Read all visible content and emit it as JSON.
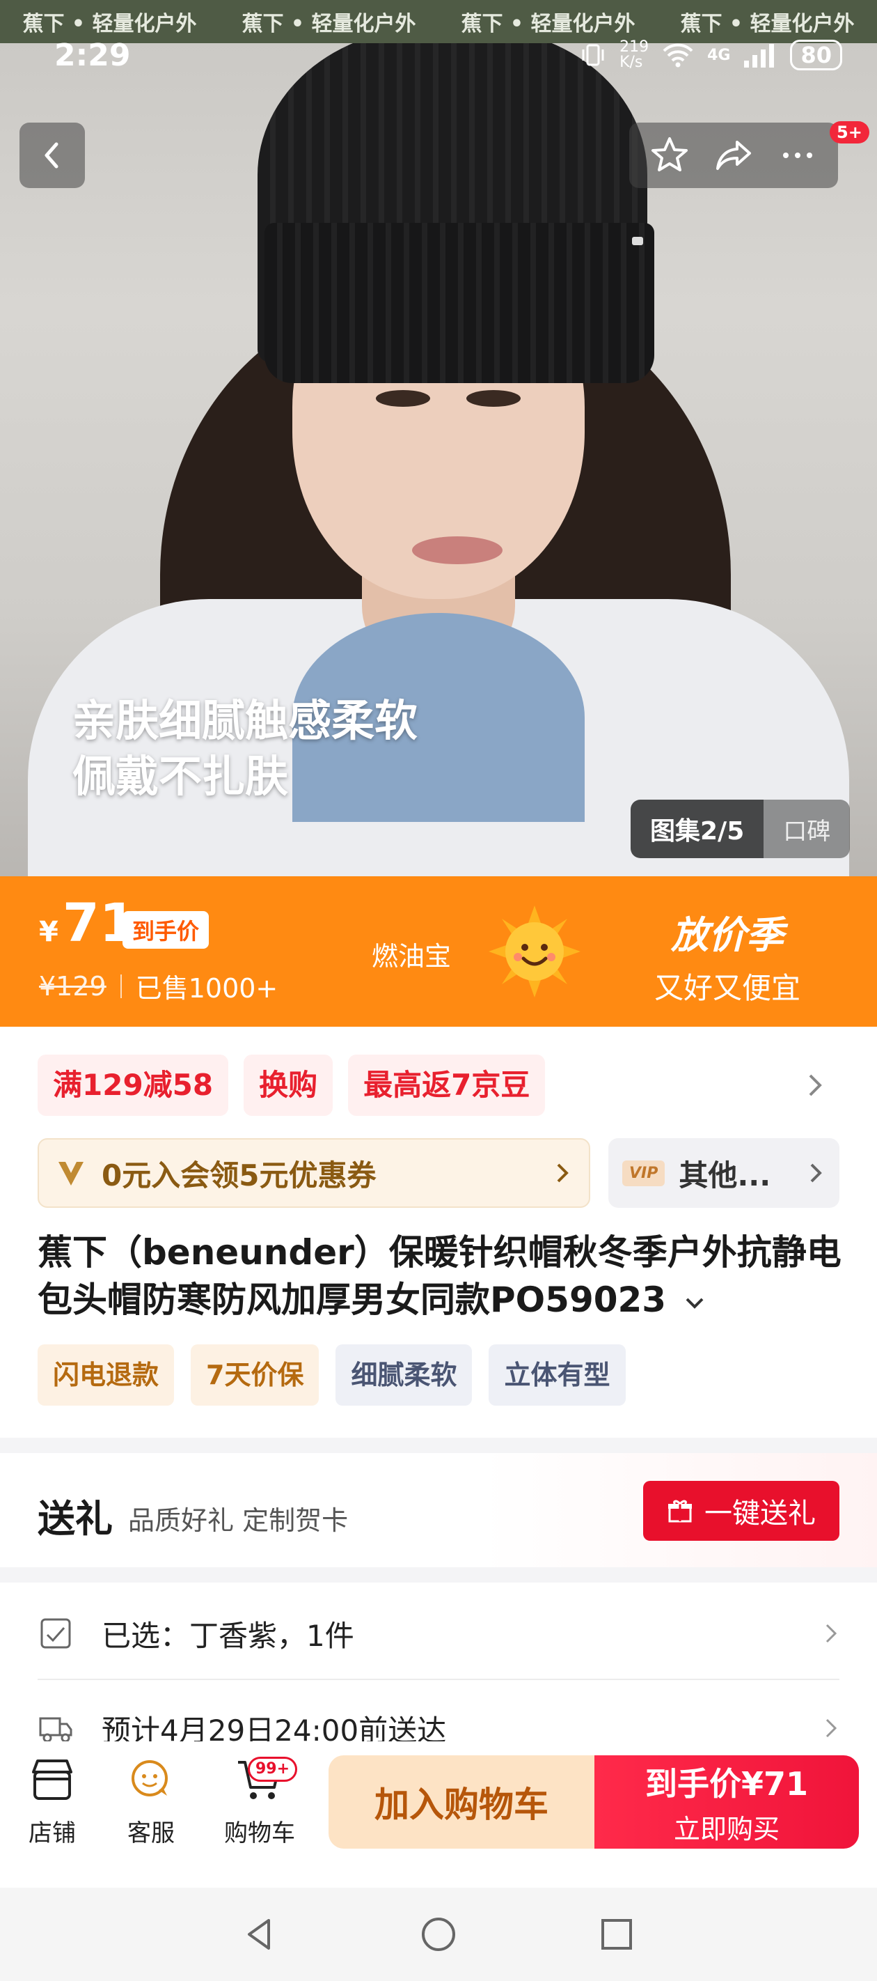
{
  "watermark": [
    "蕉下 • 轻量化户外",
    "蕉下 • 轻量化户外",
    "蕉下 • 轻量化户外",
    "蕉下 • 轻量化户外"
  ],
  "status": {
    "time": "2:29",
    "net_speed": "219\nK/s",
    "network": "4G",
    "battery": "80"
  },
  "hero": {
    "slogan_line1": "亲肤细腻触感柔软",
    "slogan_line2": "佩戴不扎肤",
    "gallery_label": "图集2/5",
    "reviews_label": "口碑",
    "more_badge": "5+"
  },
  "price": {
    "currency": "¥",
    "value": "71",
    "tag": "到手价",
    "original": "¥129",
    "sold": "已售1000+",
    "youbao": "燃油宝",
    "season_title": "放价季",
    "season_sub": "又好又便宜"
  },
  "promos": [
    "满129减58",
    "换购",
    "最高返7京豆"
  ],
  "member": {
    "text": "0元入会领5元优惠券"
  },
  "vip": {
    "badge": "VIP",
    "text": "其他..."
  },
  "product": {
    "title": "蕉下（beneunder）保暖针织帽秋冬季户外抗静电包头帽防寒防风加厚男女同款PO59023",
    "tags": [
      "闪电退款",
      "7天价保",
      "细腻柔软",
      "立体有型"
    ]
  },
  "gift": {
    "title": "送礼",
    "subtitle": "品质好礼 定制贺卡",
    "button": "一键送礼"
  },
  "rows": {
    "selected": "已选：丁香紫，1件",
    "delivery": "预计4月29日24:00前送达"
  },
  "bottom": {
    "store": "店铺",
    "service": "客服",
    "cart": "购物车",
    "cart_badge": "99+",
    "add_cart": "加入购物车",
    "buy_price": "到手价¥71",
    "buy_now": "立即购买"
  },
  "colors": {
    "accent_orange": "#ff8a12",
    "accent_red": "#e8102c"
  }
}
